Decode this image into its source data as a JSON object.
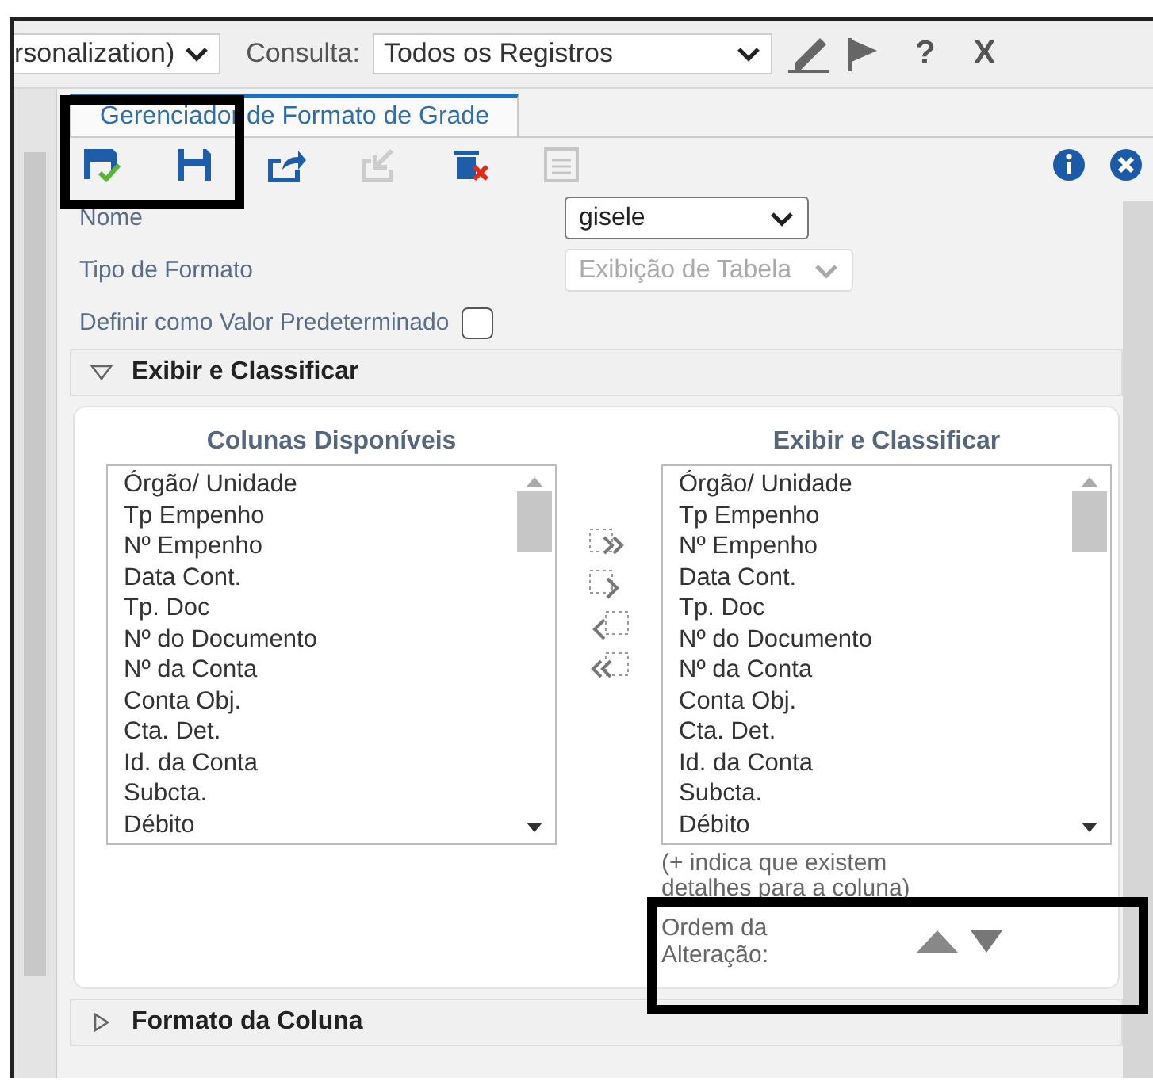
{
  "top_bar": {
    "personalization_select": "rsonalization)",
    "query_label": "Consulta:",
    "query_select": "Todos os Registros",
    "help": "?",
    "close": "X"
  },
  "tab": {
    "label": "Gerenciador de Formato de Grade",
    "selected": true
  },
  "toolbar": [
    {
      "kind": "save-check",
      "disabled": false
    },
    {
      "kind": "save",
      "disabled": false
    },
    {
      "kind": "export",
      "disabled": false
    },
    {
      "kind": "import",
      "disabled": true
    },
    {
      "kind": "delete",
      "disabled": false
    },
    {
      "kind": "notes",
      "disabled": true
    }
  ],
  "form": {
    "name_label": "Nome",
    "name_value": "gisele",
    "type_label": "Tipo de Formato",
    "type_value": "Exibição de Tabela",
    "type_disabled": true,
    "default_label": "Definir como Valor Predeterminado",
    "default_checked": false
  },
  "sections": [
    {
      "title": "Exibir e Classificar",
      "expanded": true
    },
    {
      "title": "Formato da Coluna",
      "expanded": false
    }
  ],
  "available": {
    "title": "Colunas Disponíveis",
    "items": [
      "Órgão/ Unidade",
      "Tp Empenho",
      "Nº Empenho",
      "Data Cont.",
      "Tp. Doc",
      "Nº do Documento",
      "Nº da Conta",
      "Conta Obj.",
      "Cta. Det.",
      "Id. da Conta",
      "Subcta.",
      "Débito"
    ]
  },
  "displayed": {
    "title": "Exibir e Classificar",
    "items": [
      "Órgão/ Unidade",
      "Tp Empenho",
      "Nº Empenho",
      "Data Cont.",
      "Tp. Doc",
      "Nº do Documento",
      "Nº da Conta",
      "Conta Obj.",
      "Cta. Det.",
      "Id. da Conta",
      "Subcta.",
      "Débito"
    ]
  },
  "hint": "(+ indica que existem detalhes para a coluna)",
  "order_label": "Ordem da Alteração:"
}
